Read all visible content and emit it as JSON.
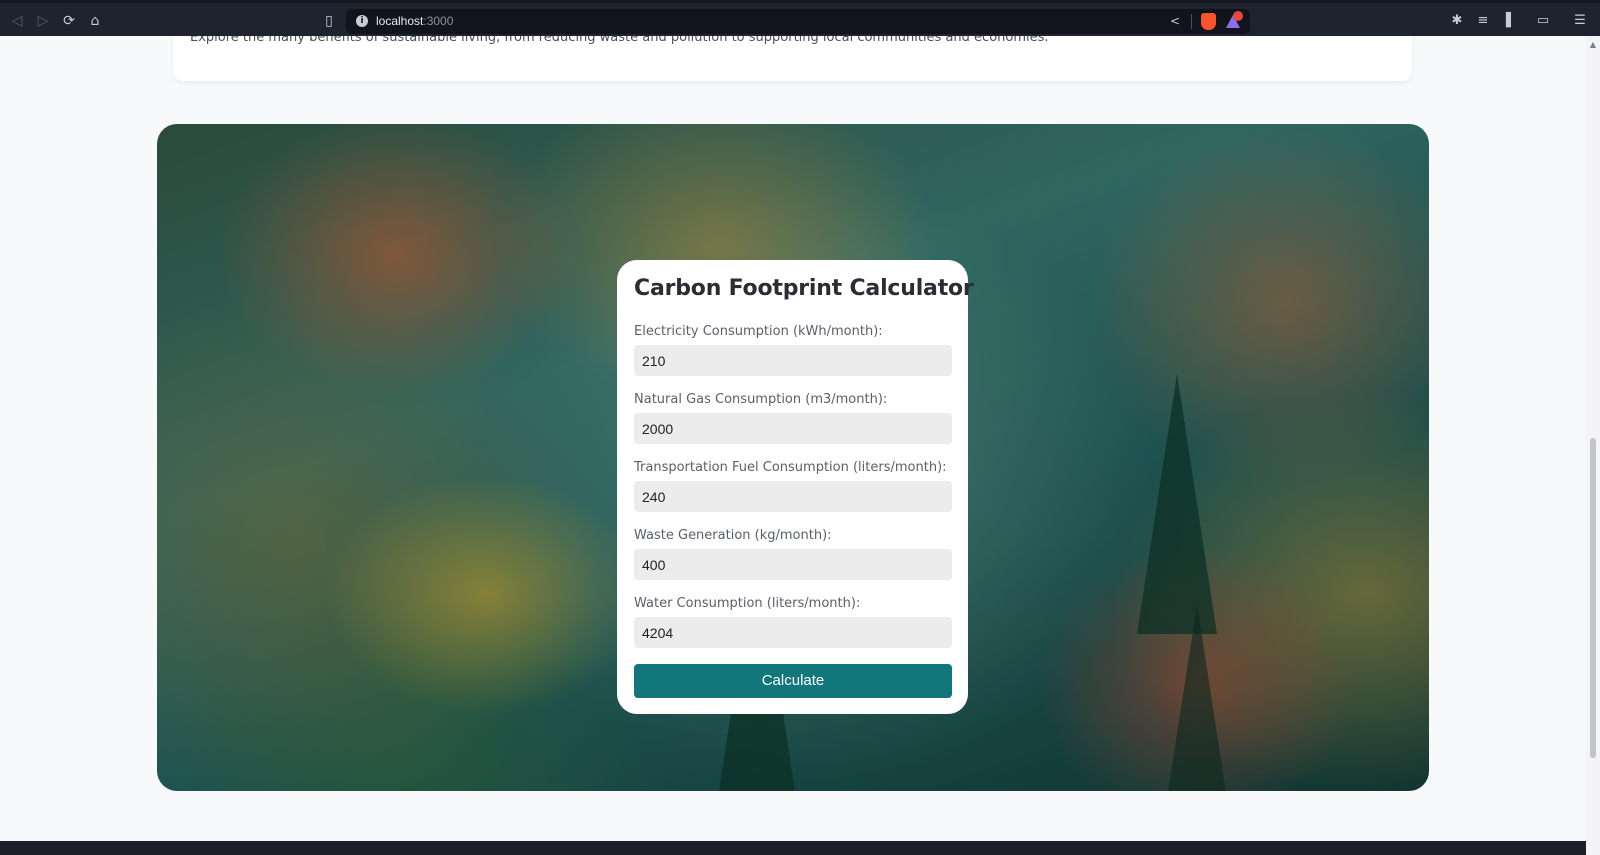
{
  "browser": {
    "url_host": "localhost",
    "url_port": ":3000",
    "icons": [
      "back-icon",
      "forward-icon",
      "reload-icon",
      "home-icon",
      "bookmark-icon",
      "site-info-icon",
      "share-icon",
      "brave-shields-icon",
      "brave-rewards-icon",
      "extensions-icon",
      "playlist-icon",
      "sidebar-icon",
      "wallet-icon",
      "menu-icon"
    ]
  },
  "intro": {
    "text": "Explore the many benefits of sustainable living, from reducing waste and pollution to supporting local communities and economies."
  },
  "calculator": {
    "title": "Carbon Footprint Calculator",
    "fields": [
      {
        "label": "Electricity Consumption (kWh/month):",
        "value": "210"
      },
      {
        "label": "Natural Gas Consumption (m3/month):",
        "value": "2000"
      },
      {
        "label": "Transportation Fuel Consumption (liters/month):",
        "value": "240"
      },
      {
        "label": "Waste Generation (kg/month):",
        "value": "400"
      },
      {
        "label": "Water Consumption (liters/month):",
        "value": "4204"
      }
    ],
    "button_label": "Calculate"
  },
  "colors": {
    "accent": "#12777a",
    "browser_bg": "#1f2330",
    "page_bg": "#f8f9fb"
  }
}
